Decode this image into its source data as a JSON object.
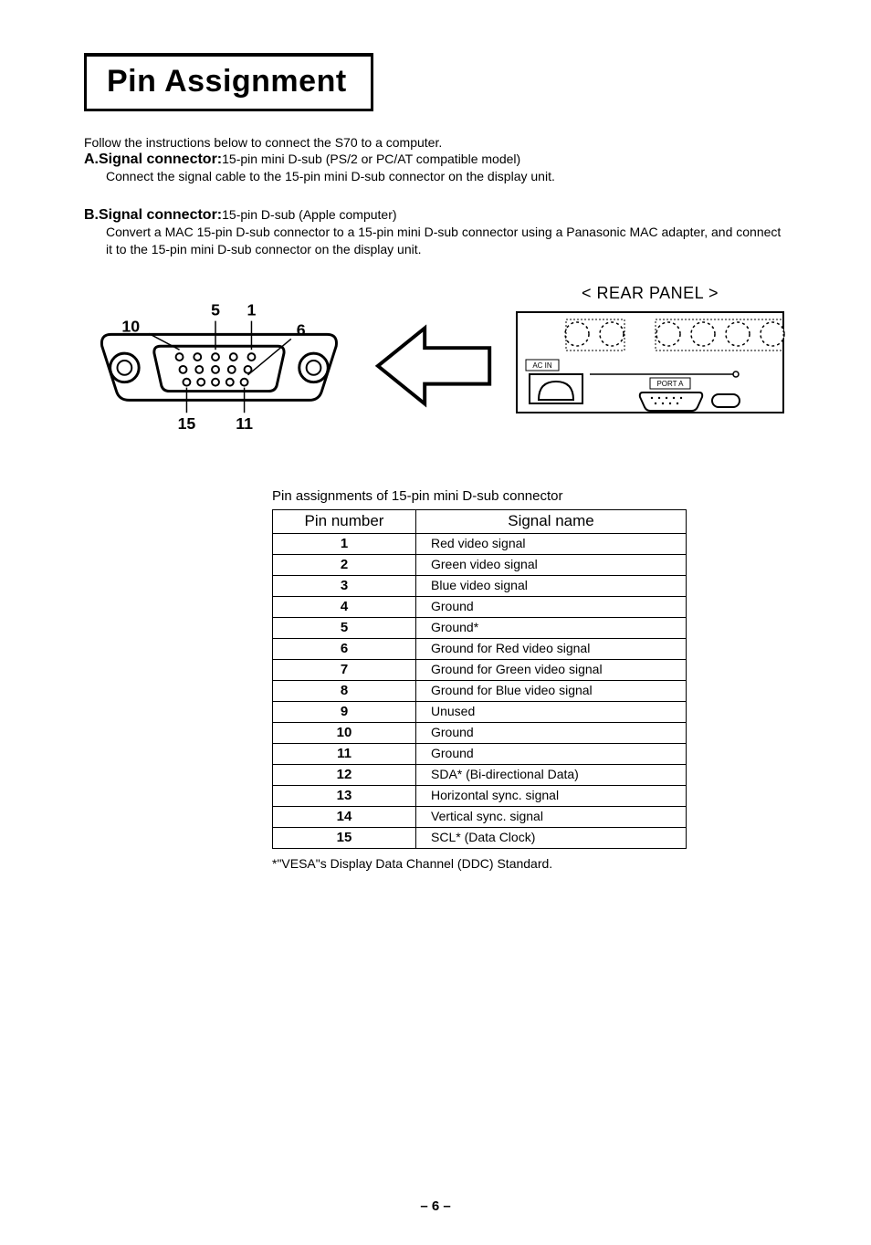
{
  "title": "Pin Assignment",
  "intro": "Follow the instructions below to connect the S70 to a computer.",
  "sectionA": {
    "label": "A.Signal connector:",
    "tail": "15-pin mini D-sub (PS/2 or PC/AT compatible model)",
    "body": "Connect the signal cable to the 15-pin mini D-sub connector on the display unit."
  },
  "sectionB": {
    "label": "B.Signal connector:",
    "tail": "15-pin D-sub (Apple computer)",
    "body": "Convert a MAC 15-pin D-sub connector to a 15-pin mini D-sub connector using a Panasonic MAC adapter, and connect it to the 15-pin mini D-sub connector on the display unit."
  },
  "rear_panel_label": "< REAR PANEL >",
  "diagram_labels": {
    "p1": "1",
    "p5": "5",
    "p6": "6",
    "p10": "10",
    "p11": "11",
    "p15": "15",
    "ac_in": "AC IN",
    "port_a": "PORT A"
  },
  "table_title": "Pin assignments of 15-pin mini D-sub connector",
  "table_headers": {
    "pin": "Pin number",
    "signal": "Signal name"
  },
  "pins": [
    {
      "num": "1",
      "signal": "Red video signal"
    },
    {
      "num": "2",
      "signal": "Green video signal"
    },
    {
      "num": "3",
      "signal": "Blue video signal"
    },
    {
      "num": "4",
      "signal": "Ground"
    },
    {
      "num": "5",
      "signal": "Ground*"
    },
    {
      "num": "6",
      "signal": "Ground  for  Red video signal"
    },
    {
      "num": "7",
      "signal": "Ground  for  Green video signal"
    },
    {
      "num": "8",
      "signal": "Ground for Blue video signal"
    },
    {
      "num": "9",
      "signal": "Unused"
    },
    {
      "num": "10",
      "signal": "Ground"
    },
    {
      "num": "11",
      "signal": "Ground"
    },
    {
      "num": "12",
      "signal": "SDA* (Bi-directional Data)"
    },
    {
      "num": "13",
      "signal": "Horizontal sync. signal"
    },
    {
      "num": "14",
      "signal": "Vertical sync. signal"
    },
    {
      "num": "15",
      "signal": "SCL* (Data Clock)"
    }
  ],
  "footnote": "*\"VESA\"s Display Data Channel (DDC) Standard.",
  "page_number": "– 6 –"
}
